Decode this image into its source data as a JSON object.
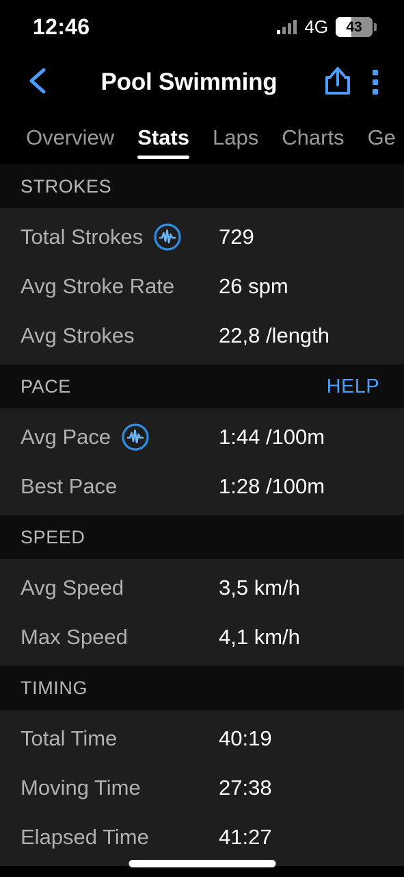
{
  "status_bar": {
    "time": "12:46",
    "network": "4G",
    "battery_percent": "43",
    "signal_icon": "signal-bars-icon",
    "battery_icon": "battery-icon"
  },
  "app_bar": {
    "title": "Pool Swimming",
    "back_icon": "chevron-left-icon",
    "share_icon": "share-icon",
    "more_icon": "kebab-menu-icon"
  },
  "tabs": [
    {
      "label": "Overview",
      "active": false
    },
    {
      "label": "Stats",
      "active": true
    },
    {
      "label": "Laps",
      "active": false
    },
    {
      "label": "Charts",
      "active": false
    },
    {
      "label": "Ge",
      "active": false
    }
  ],
  "sections": [
    {
      "title": "STROKES",
      "action": "",
      "rows": [
        {
          "label": "Total Strokes",
          "value": "729",
          "icon": "pulse-circle-icon"
        },
        {
          "label": "Avg Stroke Rate",
          "value": "26 spm",
          "icon": ""
        },
        {
          "label": "Avg Strokes",
          "value": "22,8 /length",
          "icon": ""
        }
      ]
    },
    {
      "title": "PACE",
      "action": "HELP",
      "rows": [
        {
          "label": "Avg Pace",
          "value": "1:44 /100m",
          "icon": "pulse-circle-icon"
        },
        {
          "label": "Best Pace",
          "value": "1:28 /100m",
          "icon": ""
        }
      ]
    },
    {
      "title": "SPEED",
      "action": "",
      "rows": [
        {
          "label": "Avg Speed",
          "value": "3,5 km/h",
          "icon": ""
        },
        {
          "label": "Max Speed",
          "value": "4,1 km/h",
          "icon": ""
        }
      ]
    },
    {
      "title": "TIMING",
      "action": "",
      "rows": [
        {
          "label": "Total Time",
          "value": "40:19",
          "icon": ""
        },
        {
          "label": "Moving Time",
          "value": "27:38",
          "icon": ""
        },
        {
          "label": "Elapsed Time",
          "value": "41:27",
          "icon": ""
        }
      ]
    }
  ],
  "colors": {
    "accent": "#4a9eff",
    "background": "#000000",
    "row_background": "#1e1e1e",
    "section_header_background": "#0d0d0d",
    "label_text": "#b0b0b0",
    "value_text": "#ffffff"
  }
}
